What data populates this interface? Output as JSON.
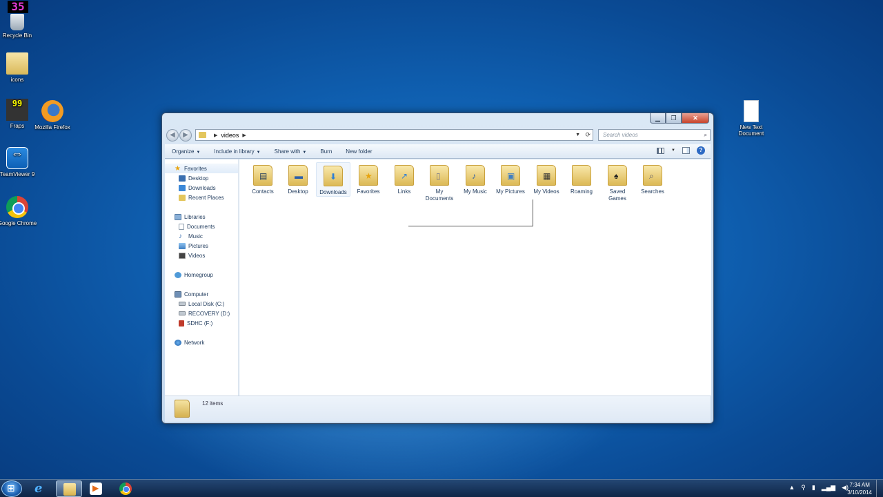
{
  "fps_counter": "35",
  "desktop_icons": [
    {
      "label": "Recycle Bin"
    },
    {
      "label": "icons"
    },
    {
      "label": "Fraps",
      "badge": "99"
    },
    {
      "label": "Mozilla Firefox"
    },
    {
      "label": "TeamViewer 9"
    },
    {
      "label": "Google Chrome"
    },
    {
      "label": "New Text Document"
    }
  ],
  "window": {
    "address": {
      "path": "videos"
    },
    "search_placeholder": "Search videos",
    "toolbar": {
      "organize": "Organize",
      "include_in_library": "Include in library",
      "share_with": "Share with",
      "burn": "Burn",
      "new_folder": "New folder"
    },
    "nav": {
      "favorites": "Favorites",
      "desktop": "Desktop",
      "downloads": "Downloads",
      "recent_places": "Recent Places",
      "libraries": "Libraries",
      "documents": "Documents",
      "music": "Music",
      "pictures": "Pictures",
      "videos": "Videos",
      "homegroup": "Homegroup",
      "computer": "Computer",
      "local_disk": "Local Disk (C:)",
      "recovery": "RECOVERY (D:)",
      "sdhc": "SDHC (F:)",
      "network": "Network"
    },
    "folders": [
      {
        "label": "Contacts",
        "icon": "contacts-icon"
      },
      {
        "label": "Desktop",
        "icon": "desktop-icon"
      },
      {
        "label": "Downloads",
        "icon": "downloads-icon"
      },
      {
        "label": "Favorites",
        "icon": "star-icon"
      },
      {
        "label": "Links",
        "icon": "links-icon"
      },
      {
        "label": "My Documents",
        "icon": "documents-icon"
      },
      {
        "label": "My Music",
        "icon": "music-icon"
      },
      {
        "label": "My Pictures",
        "icon": "pictures-icon"
      },
      {
        "label": "My Videos",
        "icon": "videos-icon"
      },
      {
        "label": "Roaming",
        "icon": "folder-icon"
      },
      {
        "label": "Saved Games",
        "icon": "games-icon"
      },
      {
        "label": "Searches",
        "icon": "search-icon"
      }
    ],
    "status": {
      "item_count": "12 items"
    }
  },
  "taskbar": {
    "time": "7:34 AM",
    "date": "3/10/2014"
  }
}
